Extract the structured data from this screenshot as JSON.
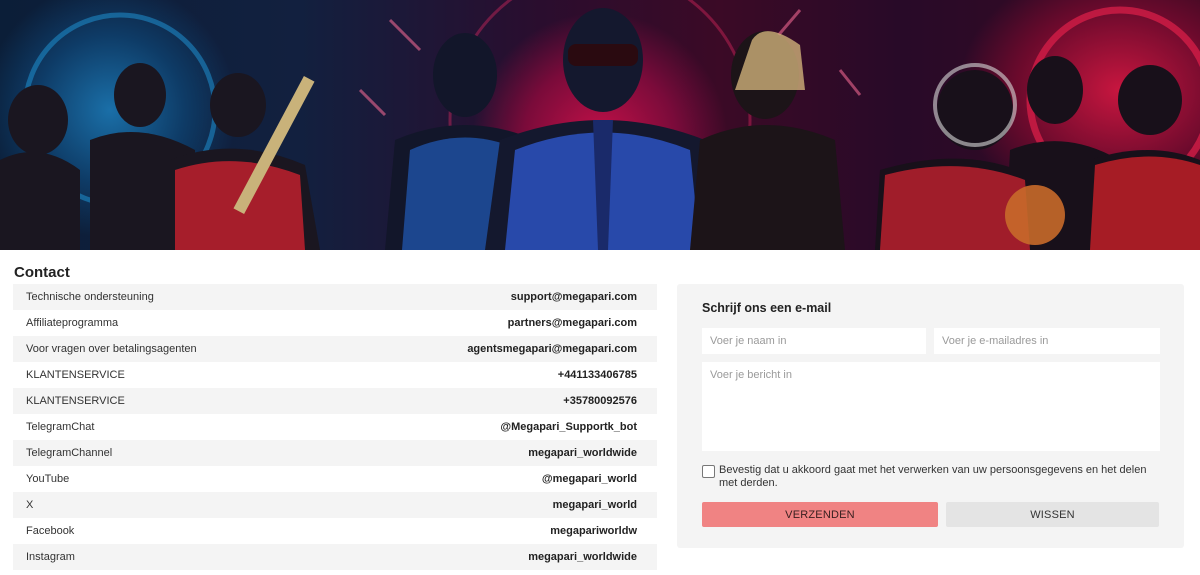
{
  "colors": {
    "row_alt": "#f4f4f4",
    "panel_bg": "#f4f4f4",
    "send_button": "#f08383",
    "clear_button": "#e4e4e4"
  },
  "banner": {
    "description_icon": "sports-personalities-banner"
  },
  "contact": {
    "title": "Contact",
    "rows": [
      {
        "label": "Technische ondersteuning",
        "value": "support@megapari.com"
      },
      {
        "label": "Affiliateprogramma",
        "value": "partners@megapari.com"
      },
      {
        "label": "Voor vragen over betalingsagenten",
        "value": "agentsmegapari@megapari.com"
      },
      {
        "label": "KLANTENSERVICE",
        "value": "+441133406785"
      },
      {
        "label": "KLANTENSERVICE",
        "value": "+35780092576"
      },
      {
        "label": "TelegramChat",
        "value": "@Megapari_Supportk_bot"
      },
      {
        "label": "TelegramChannel",
        "value": "megapari_worldwide"
      },
      {
        "label": "YouTube",
        "value": "@megapari_world"
      },
      {
        "label": "X",
        "value": "megapari_world"
      },
      {
        "label": "Facebook",
        "value": "megapariworldw"
      },
      {
        "label": "Instagram",
        "value": "megapari_worldwide"
      }
    ]
  },
  "email_form": {
    "title": "Schrijf ons een e-mail",
    "name_placeholder": "Voer je naam in",
    "email_placeholder": "Voer je e-mailadres in",
    "message_placeholder": "Voer je bericht in",
    "consent_text": "Bevestig dat u akkoord gaat met het verwerken van uw persoonsgegevens en het delen met derden.",
    "consent_checked": false,
    "send_label": "VERZENDEN",
    "clear_label": "WISSEN"
  }
}
